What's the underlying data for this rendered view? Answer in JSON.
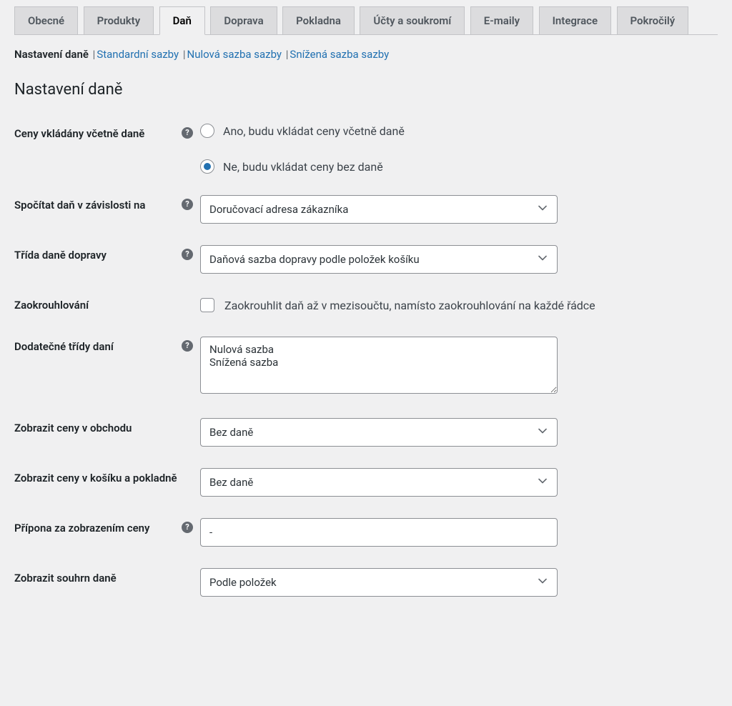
{
  "tabs": [
    {
      "label": "Obecné"
    },
    {
      "label": "Produkty"
    },
    {
      "label": "Daň"
    },
    {
      "label": "Doprava"
    },
    {
      "label": "Pokladna"
    },
    {
      "label": "Účty a soukromí"
    },
    {
      "label": "E-maily"
    },
    {
      "label": "Integrace"
    },
    {
      "label": "Pokročilý"
    }
  ],
  "active_tab_index": 2,
  "sublinks": [
    {
      "label": "Nastavení daně",
      "current": true
    },
    {
      "label": "Standardní sazby"
    },
    {
      "label": "Nulová sazba sazby"
    },
    {
      "label": "Snížená sazba sazby"
    }
  ],
  "section_title": "Nastavení daně",
  "fields": {
    "prices_include_tax": {
      "label": "Ceny vkládány včetně daně",
      "options": [
        "Ano, budu vkládat ceny včetně daně",
        "Ne, budu vkládat ceny bez daně"
      ],
      "selected_index": 1
    },
    "tax_based_on": {
      "label": "Spočítat daň v závislosti na",
      "value": "Doručovací adresa zákazníka"
    },
    "shipping_tax_class": {
      "label": "Třída daně dopravy",
      "value": "Daňová sazba dopravy podle položek košíku"
    },
    "rounding": {
      "label": "Zaokrouhlování",
      "checkbox_label": "Zaokrouhlit daň až v mezisoučtu, namísto zaokrouhlování na každé řádce"
    },
    "additional_classes": {
      "label": "Dodatečné třídy daní",
      "value": "Nulová sazba\nSnížená sazba"
    },
    "display_shop": {
      "label": "Zobrazit ceny v obchodu",
      "value": "Bez daně"
    },
    "display_cart": {
      "label": "Zobrazit ceny v košíku a pokladně",
      "value": "Bez daně"
    },
    "price_suffix": {
      "label": "Přípona za zobrazením ceny",
      "value": "-"
    },
    "tax_totals": {
      "label": "Zobrazit souhrn daně",
      "value": "Podle položek"
    }
  }
}
